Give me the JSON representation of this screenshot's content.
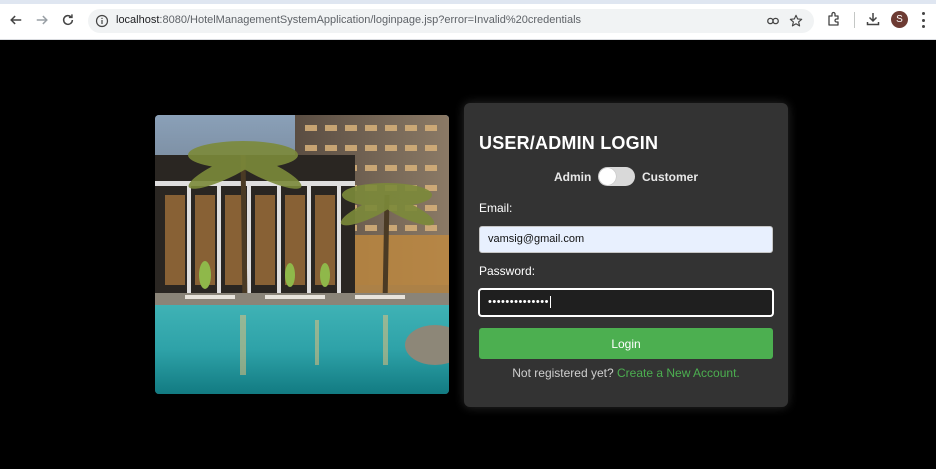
{
  "browser": {
    "url_host": "localhost",
    "url_path": ":8080/HotelManagementSystemApplication/loginpage.jsp?error=Invalid%20credentials",
    "profile_initial": "S"
  },
  "login": {
    "title": "USER/ADMIN LOGIN",
    "toggle_left_label": "Admin",
    "toggle_right_label": "Customer",
    "toggle_state": "off",
    "email_label": "Email:",
    "email_value": "vamsig@gmail.com",
    "password_label": "Password:",
    "password_masked": "••••••••••••••",
    "login_button": "Login",
    "register_prompt": "Not registered yet?",
    "register_link": "Create a New Account."
  },
  "colors": {
    "accent_green": "#4caf50",
    "card_bg": "#333333",
    "page_bg": "#000000"
  },
  "icons": [
    "back-arrow-icon",
    "forward-arrow-icon",
    "reload-icon",
    "site-info-icon",
    "password-key-icon",
    "bookmark-star-icon",
    "extensions-icon",
    "download-icon",
    "menu-kebab-icon"
  ]
}
